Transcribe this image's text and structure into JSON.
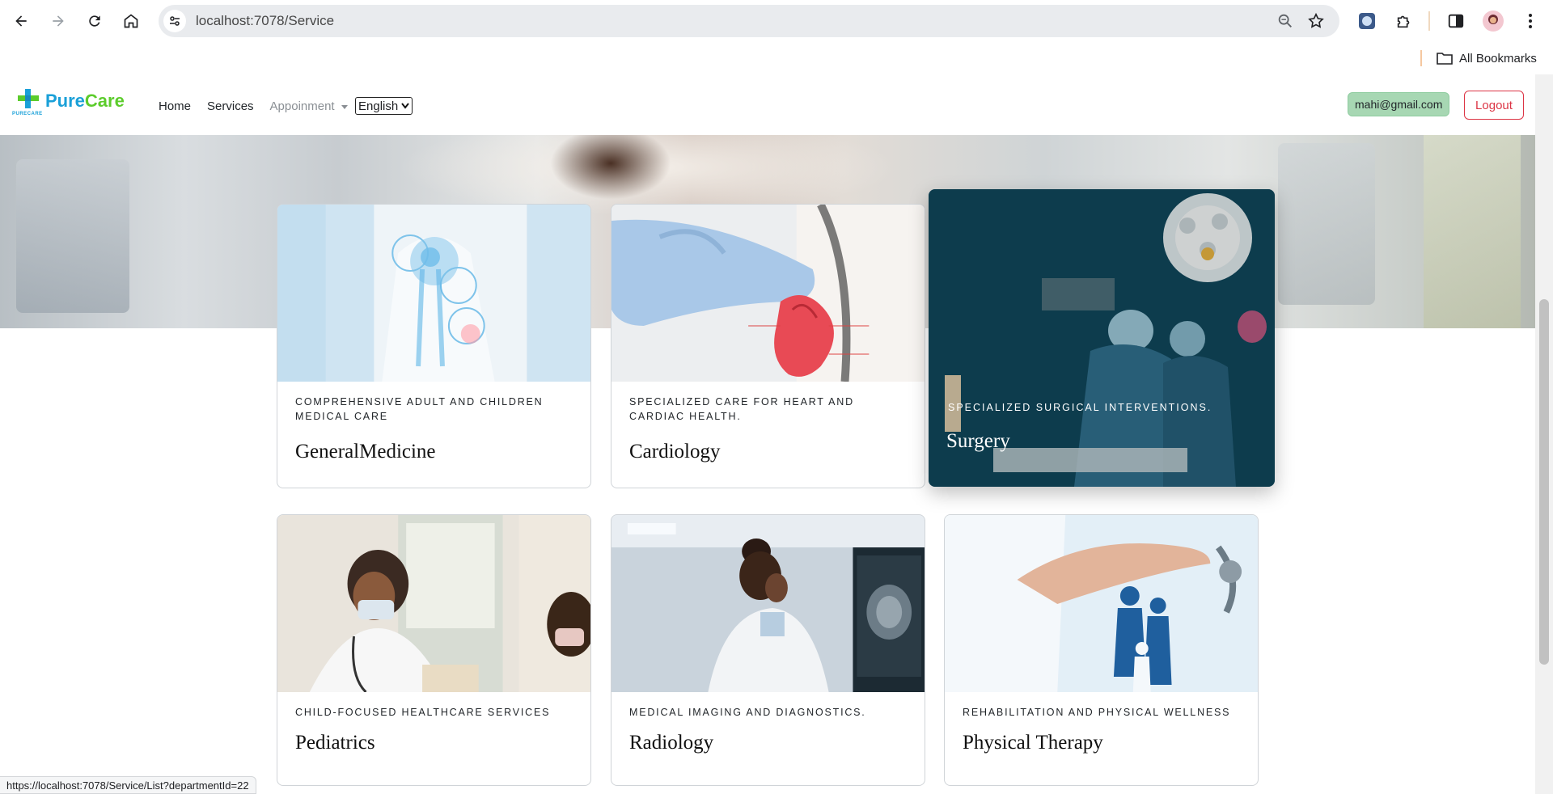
{
  "browser": {
    "url": "localhost:7078/Service",
    "bookmarks_label": "All Bookmarks",
    "status_url": "https://localhost:7078/Service/List?departmentId=22"
  },
  "header": {
    "logo_pure": "Pure",
    "logo_care": "Care",
    "logo_sub": "PURECARE",
    "nav": {
      "home": "Home",
      "services": "Services",
      "appointment": "Appoinment"
    },
    "language": "English",
    "user_email": "mahi@gmail.com",
    "logout": "Logout"
  },
  "services": [
    {
      "subtitle": "Comprehensive adult and children medical care",
      "title": "GeneralMedicine"
    },
    {
      "subtitle": "Specialized care for heart and cardiac health.",
      "title": "Cardiology"
    },
    {
      "subtitle": "Specialized surgical interventions.",
      "title": "Surgery"
    },
    {
      "subtitle": "Child-focused healthcare services",
      "title": "Pediatrics"
    },
    {
      "subtitle": "Medical imaging and diagnostics.",
      "title": "Radiology"
    },
    {
      "subtitle": "Rehabilitation and physical wellness",
      "title": "Physical Therapy"
    }
  ],
  "colors": {
    "logout": "#dc3545",
    "email_badge": "#a7d7b3",
    "logo_blue": "#1aa0d8",
    "logo_green": "#5ccc2c"
  }
}
